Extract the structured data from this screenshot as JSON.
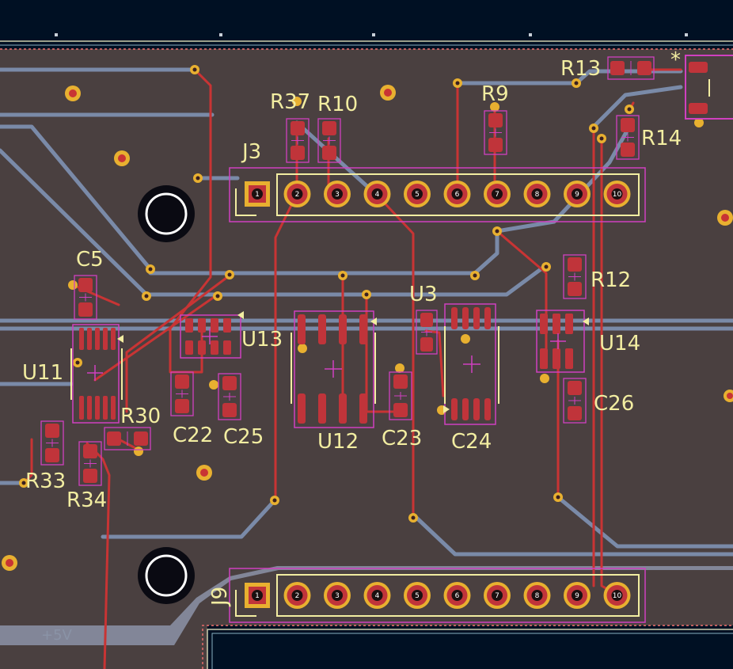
{
  "board": {
    "colors": {
      "background": "#001023",
      "board": "#4a4040",
      "edge_cut": "#d0d0b0",
      "copper_front": "#c83434",
      "copper_back": "#7a8aa8",
      "pad": "#c0343a",
      "silkscreen": "#f2eda1",
      "courtyard": "#d040c0",
      "via_ring": "#e8b030",
      "hole": "#ffffff"
    },
    "net_label": "+5V",
    "star_mark": "*"
  },
  "components": [
    {
      "ref": "J3",
      "type": "pin-header-1x10"
    },
    {
      "ref": "J9",
      "type": "pin-header-1x10"
    },
    {
      "ref": "R37",
      "type": "resistor"
    },
    {
      "ref": "R10",
      "type": "resistor"
    },
    {
      "ref": "R9",
      "type": "resistor"
    },
    {
      "ref": "R13",
      "type": "resistor"
    },
    {
      "ref": "R14",
      "type": "resistor"
    },
    {
      "ref": "R12",
      "type": "resistor"
    },
    {
      "ref": "R30",
      "type": "resistor"
    },
    {
      "ref": "R33",
      "type": "resistor"
    },
    {
      "ref": "R34",
      "type": "resistor"
    },
    {
      "ref": "C5",
      "type": "capacitor"
    },
    {
      "ref": "C22",
      "type": "capacitor"
    },
    {
      "ref": "C25",
      "type": "capacitor"
    },
    {
      "ref": "C23",
      "type": "capacitor"
    },
    {
      "ref": "C24",
      "type": "capacitor"
    },
    {
      "ref": "C26",
      "type": "capacitor"
    },
    {
      "ref": "U3",
      "type": "ic"
    },
    {
      "ref": "U11",
      "type": "ic"
    },
    {
      "ref": "U12",
      "type": "ic"
    },
    {
      "ref": "U13",
      "type": "ic"
    },
    {
      "ref": "U14",
      "type": "ic"
    }
  ],
  "header_pins": [
    "1",
    "2",
    "3",
    "4",
    "5",
    "6",
    "7",
    "8",
    "9",
    "10"
  ]
}
